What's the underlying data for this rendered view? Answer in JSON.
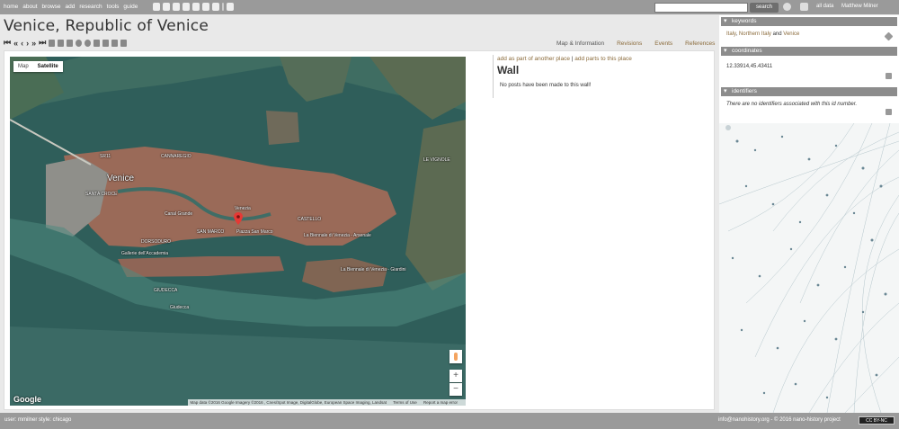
{
  "topnav": [
    "home",
    "about",
    "browse",
    "add",
    "research",
    "tools",
    "guide"
  ],
  "search": {
    "button": "search"
  },
  "user": {
    "all_data": "all data",
    "name": "Matthew Milner"
  },
  "title": "Venice, Republic of Venice",
  "tabs": [
    "Map & Information",
    "Revisions",
    "Events",
    "References"
  ],
  "map": {
    "type_buttons": [
      "Map",
      "Satellite"
    ],
    "selected_type": "Satellite",
    "logo": "Google",
    "attribution": [
      "Map data ©2016 Google Imagery ©2016 , Cnes/Spot Image, DigitalGlobe, European Space Imaging, Landsat",
      "Terms of Use",
      "Report a map error"
    ],
    "zoom_in": "+",
    "zoom_out": "−",
    "labels": {
      "venice": "Venice",
      "cannaregio": "CANNAREGIO",
      "santa_croce": "SANTA CROCE",
      "canal_grande": "Canal Grande",
      "san_marco": "SAN MARCO",
      "piazza": "Piazza San Marco",
      "venezia": "Venezia",
      "castello": "CASTELLO",
      "dorsoduro": "DORSODURO",
      "accademia": "Gallerie dell'Accademia",
      "giudecca_upper": "GIUDECCA",
      "giudecca": "Giudecca",
      "biennale_arsenale": "La Biennale di Venezia - Arsenale",
      "biennale_giardini": "La Biennale di Venezia - Giardini",
      "le_vignole": "LE VIGNOLE",
      "sr11": "SR11"
    }
  },
  "wall": {
    "link_add_part": "add as part of another place",
    "separator": "|",
    "link_add_parts": "add parts to this place",
    "title": "Wall",
    "empty": "No posts have been made to this wall!"
  },
  "sidebar": {
    "keywords_head": "keywords",
    "keywords": {
      "italy": "Italy",
      "northern_italy": "Northern Italy",
      "and": "and",
      "venice": "Venice"
    },
    "coordinates_head": "coordinates",
    "coordinates": "12.33914,45.43411",
    "identifiers_head": "identifiers",
    "identifiers": "There are no identifiers associated with this id number."
  },
  "footer": {
    "user": "user: mmilner style: chicago",
    "contact": "info@nanohistory.org - © 2016 nano-history project",
    "license": "CC BY-NC"
  },
  "colors": {
    "bar": "#9a9a9a",
    "link": "#8a6a3a",
    "water": "#2f5e5a",
    "city": "#9a6a58"
  }
}
